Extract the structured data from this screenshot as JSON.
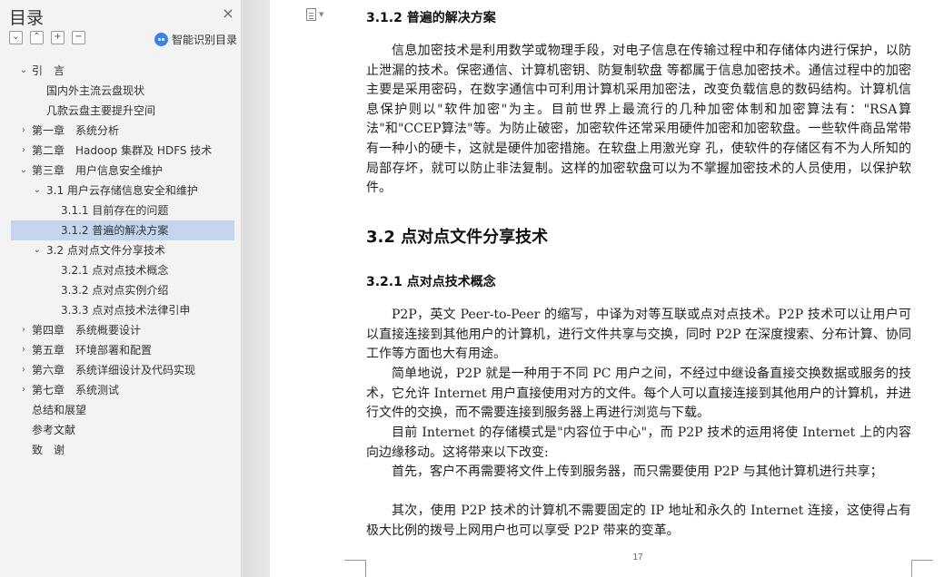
{
  "sidebar": {
    "title": "目录",
    "close_glyph": "×",
    "tools": [
      "⌄",
      "⌃",
      "+",
      "−"
    ],
    "ai_label": "智能识别目录",
    "items": [
      {
        "label": "引　言",
        "level": 1,
        "chev": "⌄",
        "active": false
      },
      {
        "label": "国内外主流云盘现状",
        "level": "2n",
        "chev": "",
        "active": false
      },
      {
        "label": "几款云盘主要提升空间",
        "level": "2n",
        "chev": "",
        "active": false
      },
      {
        "label": "第一章　系统分析",
        "level": 1,
        "chev": "›",
        "active": false
      },
      {
        "label": "第二章　Hadoop 集群及 HDFS 技术",
        "level": 1,
        "chev": "›",
        "active": false
      },
      {
        "label": "第三章　用户信息安全维护",
        "level": 1,
        "chev": "⌄",
        "active": false
      },
      {
        "label": "3.1 用户云存储信息安全和维护",
        "level": 2,
        "chev": "⌄",
        "active": false
      },
      {
        "label": "3.1.1 目前存在的问题",
        "level": 3,
        "chev": "",
        "active": false
      },
      {
        "label": "3.1.2 普遍的解决方案",
        "level": 3,
        "chev": "",
        "active": true
      },
      {
        "label": "3.2 点对点文件分享技术",
        "level": 2,
        "chev": "⌄",
        "active": false
      },
      {
        "label": "3.2.1 点对点技术概念",
        "level": 3,
        "chev": "",
        "active": false
      },
      {
        "label": "3.3.2 点对点实例介绍",
        "level": 3,
        "chev": "",
        "active": false
      },
      {
        "label": "3.3.3 点对点技术法律引申",
        "level": 3,
        "chev": "",
        "active": false
      },
      {
        "label": "第四章　系统概要设计",
        "level": 1,
        "chev": "›",
        "active": false
      },
      {
        "label": "第五章　环境部署和配置",
        "level": 1,
        "chev": "›",
        "active": false
      },
      {
        "label": "第六章　系统详细设计及代码实现",
        "level": 1,
        "chev": "›",
        "active": false
      },
      {
        "label": "第七章　系统测试",
        "level": 1,
        "chev": "›",
        "active": false
      },
      {
        "label": "总结和展望",
        "level": 1,
        "chev": "",
        "active": false
      },
      {
        "label": "参考文献",
        "level": 1,
        "chev": "",
        "active": false
      },
      {
        "label": "致　谢",
        "level": 1,
        "chev": "",
        "active": false
      }
    ]
  },
  "document": {
    "h_312": "3.1.2 普遍的解决方案",
    "p_312": "信息加密技术是利用数学或物理手段，对电子信息在传输过程中和存储体内进行保护，以防止泄漏的技术。保密通信、计算机密钥、防复制软盘 等都属于信息加密技术。通信过程中的加密主要是采用密码，在数字通信中可利用计算机采用加密法，改变负载信息的数码结构。计算机信息保护则以\"软件加密\"为主。目前世界上最流行的几种加密体制和加密算法有：\"RSA算法\"和\"CCEP算法\"等。为防止破密，加密软件还常采用硬件加密和加密软盘。一些软件商品常带有一种小的硬卡，这就是硬件加密措施。在软盘上用激光穿 孔，使软件的存储区有不为人所知的局部存坏，就可以防止非法复制。这样的加密软盘可以为不掌握加密技术的人员使用，以保护软件。",
    "h_32": "3.2 点对点文件分享技术",
    "h_321": "3.2.1  点对点技术概念",
    "p_321_a": "P2P，英文 Peer-to-Peer 的缩写，中译为对等互联或点对点技术。P2P 技术可以让用户可以直接连接到其他用户的计算机，进行文件共享与交换，同时 P2P 在深度搜索、分布计算、协同工作等方面也大有用途。",
    "p_321_b": "简单地说，P2P 就是一种用于不同 PC 用户之间，不经过中继设备直接交换数据或服务的技术，它允许 Internet 用户直接使用对方的文件。每个人可以直接连接到其他用户的计算机，并进行文件的交换，而不需要连接到服务器上再进行浏览与下载。",
    "p_321_c": "目前 Internet 的存储模式是\"内容位于中心\"，而 P2P 技术的运用将使 Internet 上的内容向边缘移动。这将带来以下改变:",
    "p_321_d": "首先，客户不再需要将文件上传到服务器，而只需要使用 P2P 与其他计算机进行共享；",
    "p_321_e": "其次，使用 P2P 技术的计算机不需要固定的 IP 地址和永久的 Internet 连接，这使得占有极大比例的拨号上网用户也可以享受 P2P 带来的变革。",
    "page_number": "17"
  }
}
